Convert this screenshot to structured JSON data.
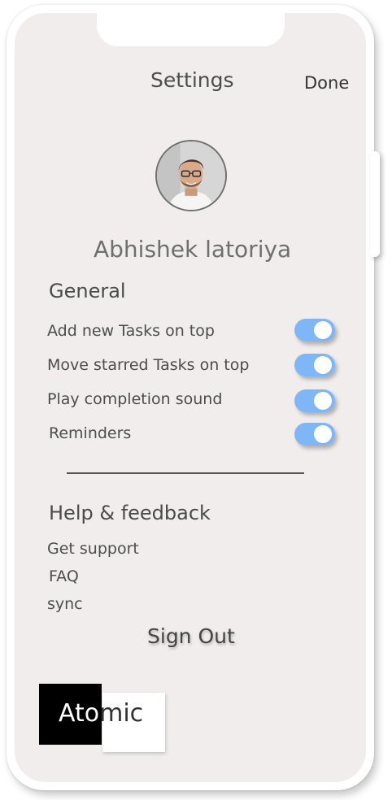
{
  "header": {
    "title": "Settings",
    "done_label": "Done"
  },
  "profile": {
    "avatar_icon": "user-avatar-photo",
    "name": "Abhishek latoriya"
  },
  "general": {
    "heading": "General",
    "options": [
      {
        "label": "Add new Tasks on top",
        "enabled": true
      },
      {
        "label": "Move starred Tasks on top",
        "enabled": true
      },
      {
        "label": "Play completion sound",
        "enabled": true
      },
      {
        "label": "Reminders",
        "enabled": true
      }
    ]
  },
  "help": {
    "heading": "Help & feedback",
    "links": [
      "Get support",
      "FAQ",
      "sync"
    ]
  },
  "sign_out_label": "Sign Out",
  "logo": {
    "part1": "Ato",
    "part2": "mic"
  },
  "colors": {
    "screen_bg": "#f0edec",
    "toggle_on": "#7fb6f7",
    "text": "#4d4d4d"
  }
}
